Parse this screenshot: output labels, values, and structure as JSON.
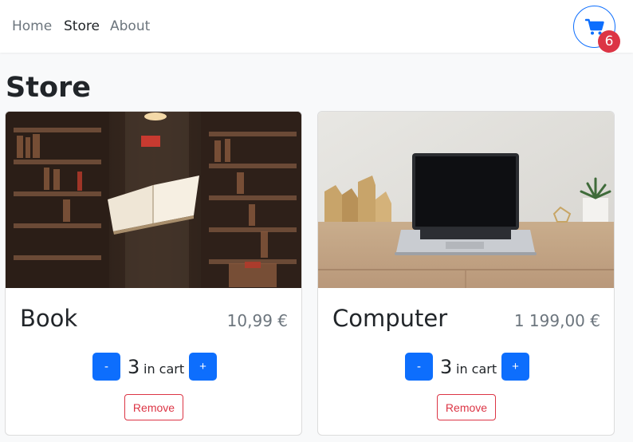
{
  "nav": {
    "links": [
      {
        "label": "Home",
        "active": false
      },
      {
        "label": "Store",
        "active": true
      },
      {
        "label": "About",
        "active": false
      }
    ],
    "cart": {
      "icon": "cart-icon",
      "count": "6",
      "accent": "#0d6efd",
      "badge_color": "#dc3545"
    }
  },
  "page": {
    "title": "Store"
  },
  "products": [
    {
      "name": "Book",
      "price": "10,99 €",
      "image": "flying-book-library-photo",
      "quantity": "3",
      "in_cart_label": "in cart",
      "decrement_label": "-",
      "increment_label": "+",
      "remove_label": "Remove"
    },
    {
      "name": "Computer",
      "price": "1 199,00 €",
      "image": "laptop-on-desk-photo",
      "quantity": "3",
      "in_cart_label": "in cart",
      "decrement_label": "-",
      "increment_label": "+",
      "remove_label": "Remove"
    }
  ]
}
